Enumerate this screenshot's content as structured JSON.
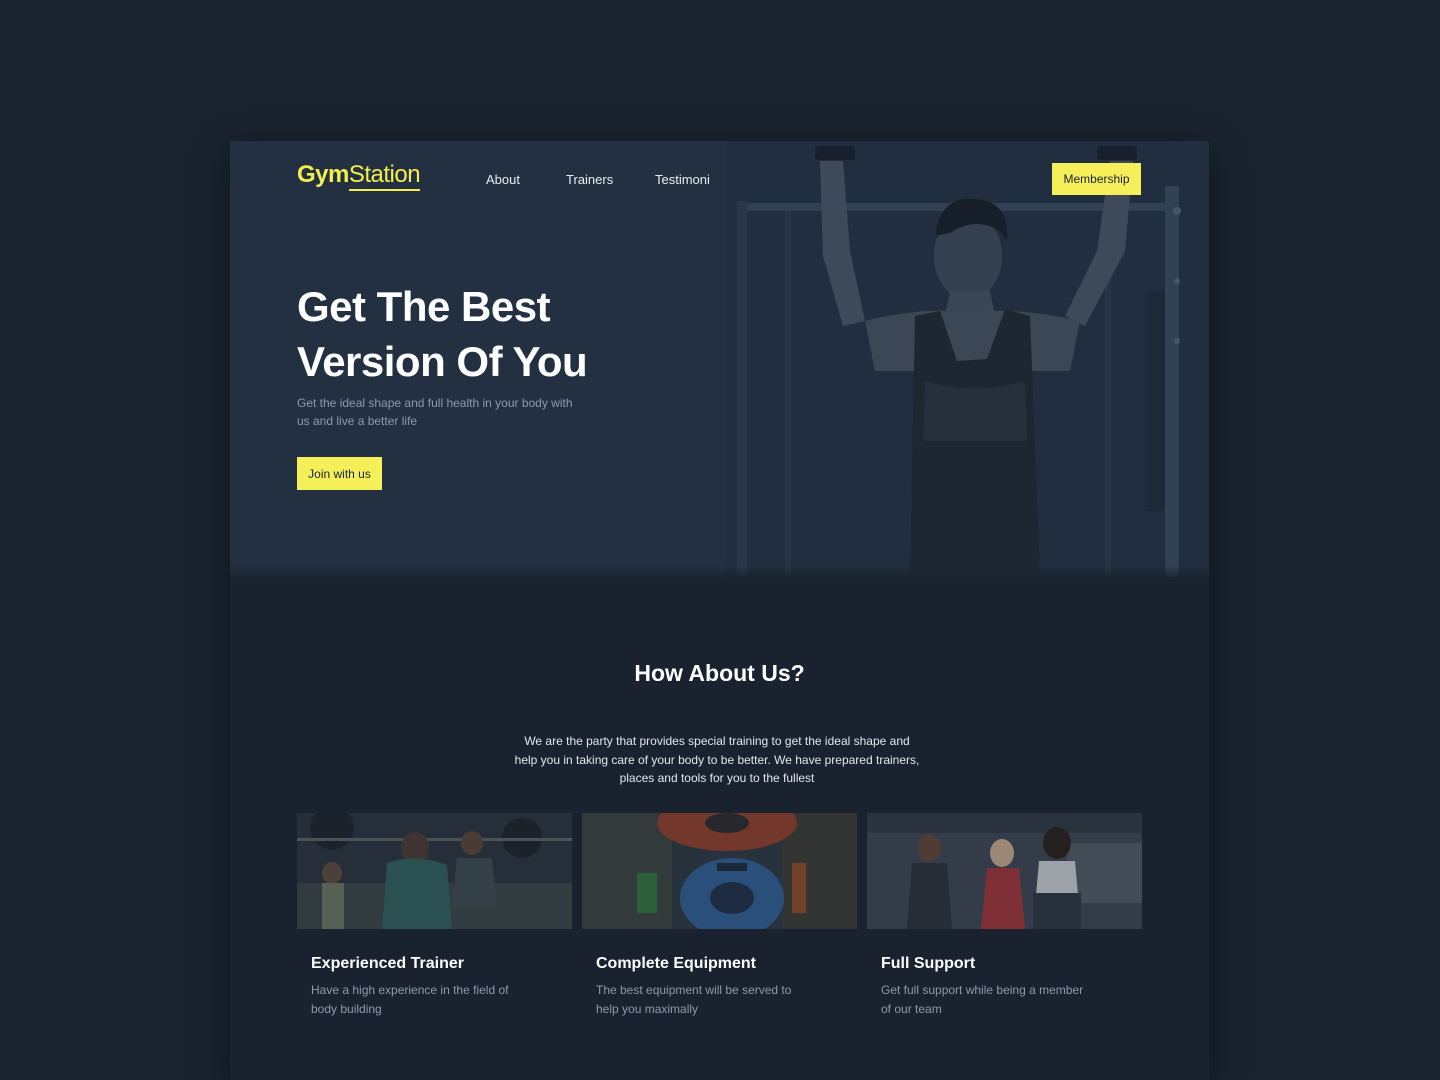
{
  "brand": {
    "part1": "Gym",
    "part2": "Station"
  },
  "nav": [
    "About",
    "Trainers",
    "Testimoni"
  ],
  "header": {
    "membership_label": "Membership"
  },
  "hero": {
    "title_line1": "Get The Best",
    "title_line2": "Version Of You",
    "subtitle": "Get the ideal shape and full health in your body with us and live a better life",
    "cta_label": "Join with us"
  },
  "about": {
    "title": "How About Us?",
    "text": "We are the party that provides special training to get the ideal shape and help you in taking care of your body to be better. We have prepared trainers, places and tools for you to the fullest",
    "cards": [
      {
        "title": "Experienced Trainer",
        "text": "Have a high experience in the field of body building"
      },
      {
        "title": "Complete Equipment",
        "text": "The best equipment will be served to help you maximally"
      },
      {
        "title": "Full Support",
        "text": "Get full support while being a member of our team"
      }
    ]
  },
  "colors": {
    "accent": "#f5f05a",
    "background": "#1a2330",
    "hero_bg": "#223042"
  }
}
